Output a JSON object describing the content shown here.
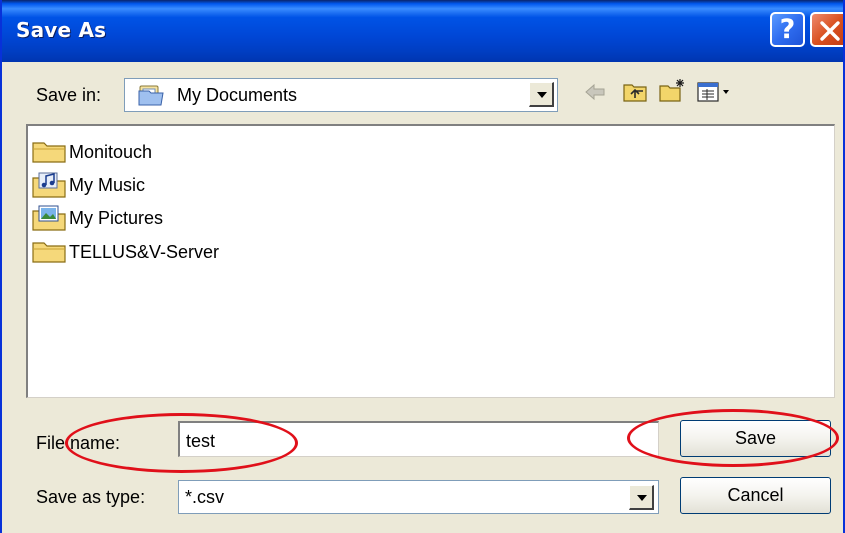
{
  "dialog": {
    "title": "Save As"
  },
  "title_buttons": {
    "help_label": "?"
  },
  "save_in": {
    "label": "Save in:",
    "value": "My Documents"
  },
  "toolbar": {
    "icons": [
      "back-arrow-icon",
      "up-folder-icon",
      "new-folder-icon",
      "view-menu-icon"
    ]
  },
  "files": {
    "items": [
      {
        "name": "Monitouch",
        "icon": "folder-icon"
      },
      {
        "name": "My Music",
        "icon": "music-folder-icon"
      },
      {
        "name": "My Pictures",
        "icon": "pictures-folder-icon"
      },
      {
        "name": "TELLUS&V-Server",
        "icon": "folder-icon"
      }
    ]
  },
  "file_name": {
    "label": "File name:",
    "value": "test"
  },
  "save_as_type": {
    "label": "Save as type:",
    "value": "*.csv"
  },
  "buttons": {
    "save": "Save",
    "cancel": "Cancel"
  },
  "colors": {
    "title_bar": "#0054e3",
    "dialog_bg": "#ece9d8",
    "annotation": "#e0101a"
  }
}
